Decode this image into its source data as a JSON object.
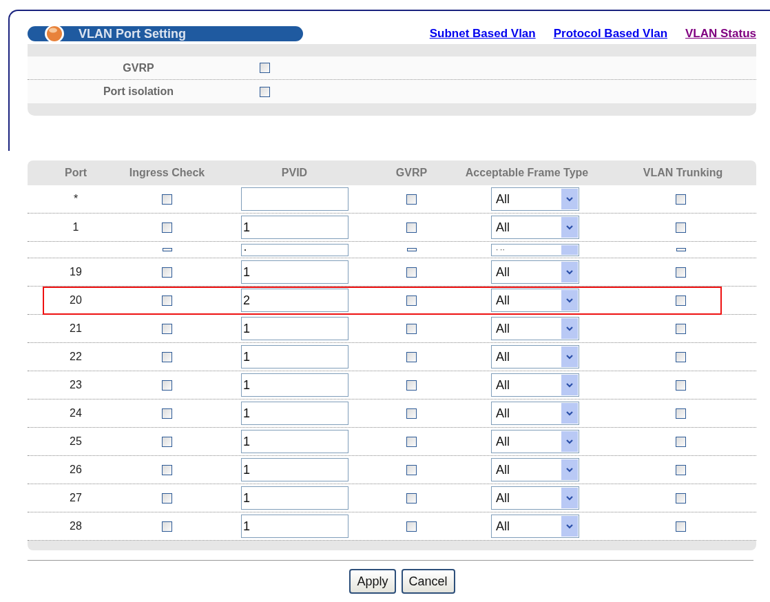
{
  "header": {
    "title": "VLAN Port Setting"
  },
  "links": [
    {
      "label": "Subnet Based Vlan",
      "visited": false
    },
    {
      "label": "Protocol Based Vlan",
      "visited": false
    },
    {
      "label": "VLAN Status",
      "visited": true
    }
  ],
  "settings": [
    {
      "label": "GVRP",
      "checked": false
    },
    {
      "label": "Port isolation",
      "checked": false
    }
  ],
  "table": {
    "columns": [
      "Port",
      "Ingress Check",
      "PVID",
      "GVRP",
      "Acceptable Frame Type",
      "VLAN Trunking"
    ],
    "rows": [
      {
        "kind": "full",
        "port": "*",
        "ingress_check": false,
        "pvid": "",
        "gvrp": false,
        "frame_type": "All",
        "vlan_trunking": false,
        "highlighted": false
      },
      {
        "kind": "full",
        "port": "1",
        "ingress_check": false,
        "pvid": "1",
        "gvrp": false,
        "frame_type": "All",
        "vlan_trunking": false,
        "highlighted": false
      },
      {
        "kind": "collapsed",
        "ingress_check": false,
        "pvid": "·",
        "gvrp": false,
        "frame_type": "· ··",
        "vlan_trunking": false
      },
      {
        "kind": "full",
        "port": "19",
        "ingress_check": false,
        "pvid": "1",
        "gvrp": false,
        "frame_type": "All",
        "vlan_trunking": false,
        "highlighted": false
      },
      {
        "kind": "full",
        "port": "20",
        "ingress_check": false,
        "pvid": "2",
        "gvrp": false,
        "frame_type": "All",
        "vlan_trunking": false,
        "highlighted": true
      },
      {
        "kind": "full",
        "port": "21",
        "ingress_check": false,
        "pvid": "1",
        "gvrp": false,
        "frame_type": "All",
        "vlan_trunking": false,
        "highlighted": false
      },
      {
        "kind": "full",
        "port": "22",
        "ingress_check": false,
        "pvid": "1",
        "gvrp": false,
        "frame_type": "All",
        "vlan_trunking": false,
        "highlighted": false
      },
      {
        "kind": "full",
        "port": "23",
        "ingress_check": false,
        "pvid": "1",
        "gvrp": false,
        "frame_type": "All",
        "vlan_trunking": false,
        "highlighted": false
      },
      {
        "kind": "full",
        "port": "24",
        "ingress_check": false,
        "pvid": "1",
        "gvrp": false,
        "frame_type": "All",
        "vlan_trunking": false,
        "highlighted": false
      },
      {
        "kind": "full",
        "port": "25",
        "ingress_check": false,
        "pvid": "1",
        "gvrp": false,
        "frame_type": "All",
        "vlan_trunking": false,
        "highlighted": false
      },
      {
        "kind": "full",
        "port": "26",
        "ingress_check": false,
        "pvid": "1",
        "gvrp": false,
        "frame_type": "All",
        "vlan_trunking": false,
        "highlighted": false
      },
      {
        "kind": "full",
        "port": "27",
        "ingress_check": false,
        "pvid": "1",
        "gvrp": false,
        "frame_type": "All",
        "vlan_trunking": false,
        "highlighted": false
      },
      {
        "kind": "full",
        "port": "28",
        "ingress_check": false,
        "pvid": "1",
        "gvrp": false,
        "frame_type": "All",
        "vlan_trunking": false,
        "highlighted": false
      }
    ]
  },
  "buttons": [
    "Apply",
    "Cancel"
  ]
}
